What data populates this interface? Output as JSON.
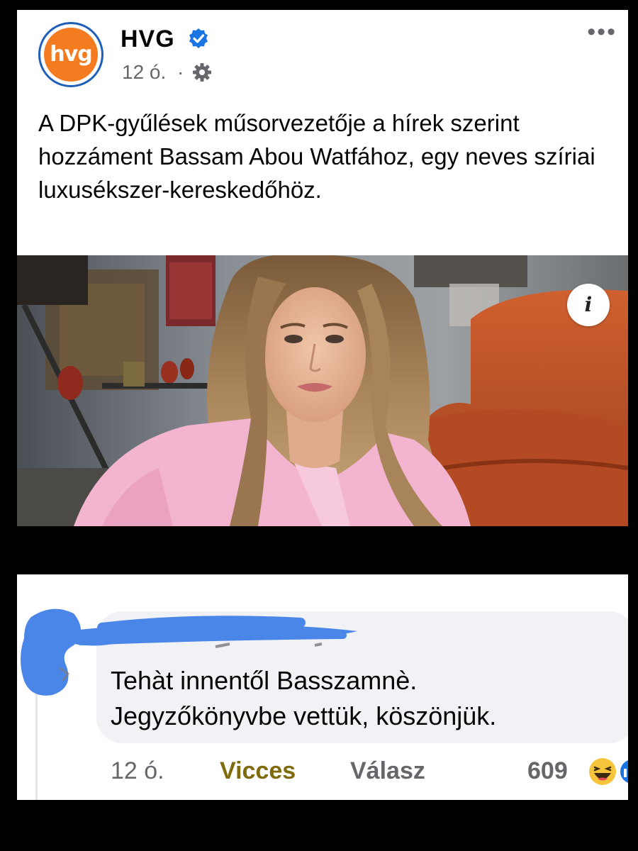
{
  "post": {
    "page_name": "HVG",
    "avatar_text": "hvg",
    "time": "12 ó.",
    "dot": "·",
    "text": "A DPK-gyűlések műsorvezetője a hírek szerint hozzáment Bassam Abou Watfához, egy neves szíriai luxusékszer-kereskedőhöz.",
    "info_label": "i",
    "more_label": "•••",
    "icons": {
      "verified": "verified-badge-icon",
      "audience": "gear-icon",
      "more": "more-options-icon",
      "info": "info-icon"
    },
    "colors": {
      "brand_orange": "#f47b20",
      "brand_blue": "#1f5fb8",
      "verified_blue": "#1b74e4",
      "jacket_pink": "#f3b4cf",
      "sofa_orange": "#c0512a"
    }
  },
  "comment": {
    "commenter_name": "",
    "text_line1": "Tehàt innentől Basszamnè.",
    "text_line2": "Jegyzőkönyvbe vettük, köszönjük.",
    "time": "12 ó.",
    "reaction_label": "Vicces",
    "reply_label": "Válasz",
    "reaction_count": "609",
    "icons": {
      "reaction": "haha-emoji-icon",
      "redaction": "blue-scribble-redaction"
    },
    "colors": {
      "reaction_text": "#7f6a0c",
      "redaction_blue": "#4a86e8"
    }
  }
}
